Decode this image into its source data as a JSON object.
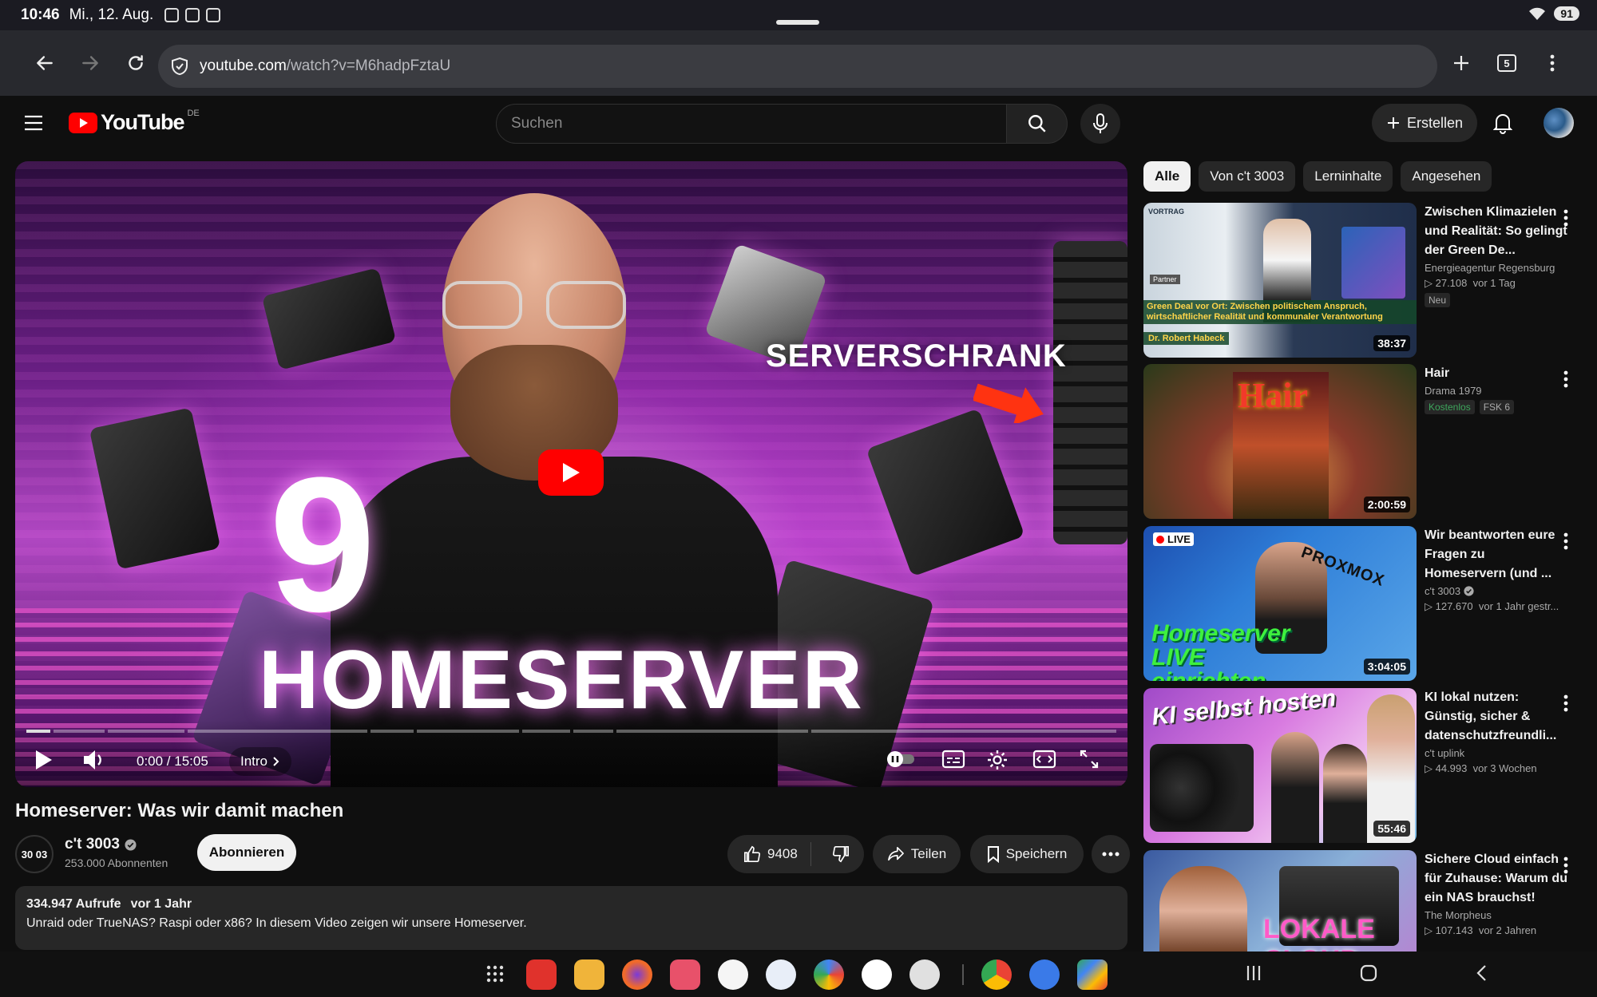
{
  "status_bar": {
    "time": "10:46",
    "date": "Mi., 12. Aug.",
    "battery": "91"
  },
  "browser": {
    "url_host": "youtube.com",
    "url_path": "/watch?v=M6hadpFztaU",
    "tab_count": "5"
  },
  "header": {
    "logo_text": "YouTube",
    "country_code": "DE",
    "search_placeholder": "Suchen",
    "create_label": "Erstellen"
  },
  "player": {
    "thumb_tag": "SERVERSCHRANK",
    "thumb_number": "9",
    "thumb_title": "HOMESERVER",
    "time": "0:00 / 15:05",
    "chapter": "Intro",
    "progress": 0.0
  },
  "video": {
    "title": "Homeserver: Was wir damit machen",
    "channel_avatar": "30 03",
    "channel": "c't 3003",
    "subscribers": "253.000 Abonnenten",
    "subscribe_label": "Abonnieren",
    "likes": "9408",
    "share_label": "Teilen",
    "save_label": "Speichern",
    "views": "334.947 Aufrufe",
    "age": "vor 1 Jahr",
    "description": "Unraid oder TrueNAS? Raspi oder x86? In diesem Video zeigen wir unsere Homeserver."
  },
  "chips": [
    "Alle",
    "Von c't 3003",
    "Lerninhalte",
    "Angesehen"
  ],
  "recommendations": [
    {
      "title": "Zwischen Klimazielen und Realität: So gelingt der Green De...",
      "channel": "Energieagentur Regensburg",
      "views": "27.108",
      "age": "vor 1 Tag",
      "badge": "Neu",
      "duration": "38:37",
      "thumb_text": "Green Deal vor Ort: Zwischen politischem Anspruch, wirtschaftlicher Realität und kommunaler Verantwortung",
      "thumb_label": "VORTRAG",
      "thumb_partner": "Partner",
      "thumb_speaker": "Dr. Robert Habeck"
    },
    {
      "title": "Hair",
      "channel": "Drama 1979",
      "badge_free": "Kostenlos",
      "badge_age": "FSK 6",
      "duration": "2:00:59",
      "thumb_text": "Hair"
    },
    {
      "title": "Wir beantworten eure Fragen zu Homeservern (und ...",
      "channel": "c't 3003",
      "views": "127.670",
      "age": "vor 1 Jahr gestr...",
      "duration": "3:04:05",
      "thumb_text": "Homeserver LIVE einrichten",
      "thumb_live": "LIVE",
      "thumb_brand": "PROXMOX"
    },
    {
      "title": "KI lokal nutzen: Günstig, sicher & datenschutzfreundli...",
      "channel": "c't uplink",
      "views": "44.993",
      "age": "vor 3 Wochen",
      "duration": "55:46",
      "thumb_text": "KI selbst hosten"
    },
    {
      "title": "Sichere Cloud einfach für Zuhause: Warum du ein NAS brauchst!",
      "channel": "The Morpheus",
      "views": "107.143",
      "age": "vor 2 Jahren",
      "thumb_text": "LOKALE CLOUD"
    }
  ],
  "colors": {
    "background": "#0f0f0f",
    "accent_red": "#ff0000",
    "chip_active": "#f1f1f1"
  }
}
